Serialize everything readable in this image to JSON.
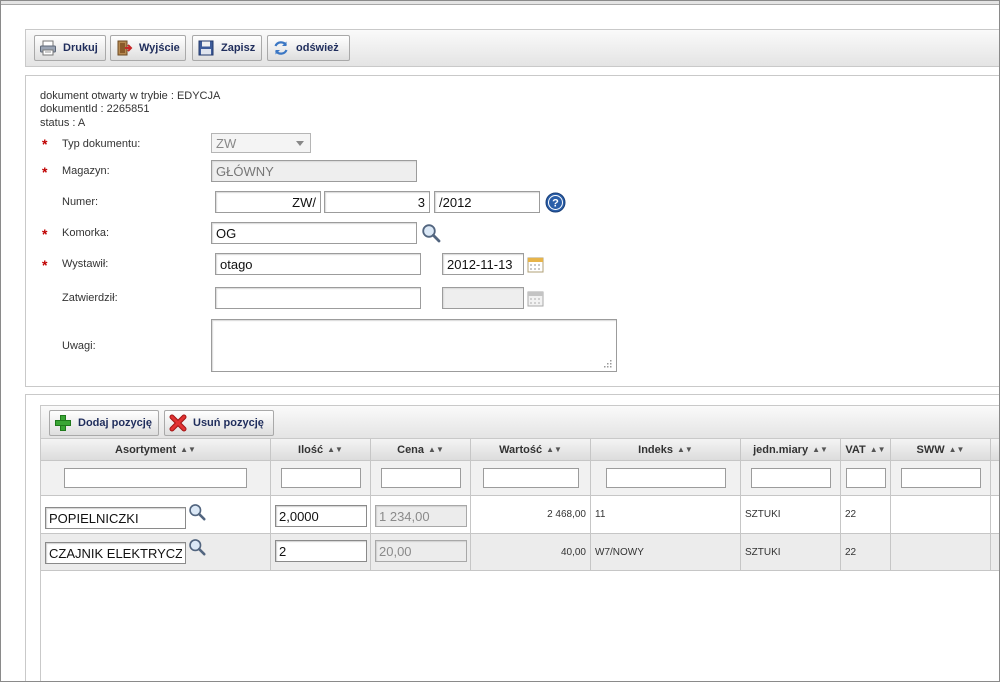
{
  "toolbar": {
    "print_label": "Drukuj",
    "exit_label": "Wyjście",
    "save_label": "Zapisz",
    "refresh_label": "odśwież"
  },
  "info": {
    "mode_line": "dokument otwarty w trybie : EDYCJA",
    "id_line": "dokumentId : 2265851",
    "status_line": "status : A"
  },
  "form": {
    "typ_label": "Typ dokumentu:",
    "typ_value": "ZW",
    "magazyn_label": "Magazyn:",
    "magazyn_value": "GŁÓWNY",
    "numer_label": "Numer:",
    "numer_prefix": "ZW/",
    "numer_value": "3",
    "numer_suffix": "/2012",
    "komorka_label": "Komorka:",
    "komorka_value": "OG",
    "wystawil_label": "Wystawił:",
    "wystawil_value": "otago",
    "wystawil_date": "2012-11-13",
    "zatwierdzil_label": "Zatwierdził:",
    "zatwierdzil_value": "",
    "zatwierdzil_date": "",
    "uwagi_label": "Uwagi:",
    "uwagi_value": ""
  },
  "grid_toolbar": {
    "add_label": "Dodaj pozycję",
    "remove_label": "Usuń pozycję"
  },
  "columns": [
    "Asortyment",
    "Ilość",
    "Cena",
    "Wartość",
    "Indeks",
    "jedn.miary",
    "VAT",
    "SWW"
  ],
  "rows": [
    {
      "asortyment": "POPIELNICZKI",
      "ilosc": "2,0000",
      "cena": "1 234,00",
      "wartosc": "2 468,00",
      "indeks": "11",
      "jm": "SZTUKI",
      "vat": "22",
      "sww": ""
    },
    {
      "asortyment": "CZAJNIK ELEKTRYCZ",
      "ilosc": "2",
      "cena": "20,00",
      "wartosc": "40,00",
      "indeks": "W7/NOWY",
      "jm": "SZTUKI",
      "vat": "22",
      "sww": ""
    }
  ],
  "icons": {
    "print": "printer-icon",
    "exit": "exit-door-icon",
    "save": "floppy-disk-icon",
    "refresh": "refresh-icon",
    "help": "help-icon",
    "search": "search-icon",
    "calendar": "calendar-icon",
    "add": "plus-icon",
    "remove": "delete-x-icon"
  },
  "colors": {
    "required": "#c00000",
    "button_text": "#1f2d5c",
    "help_blue": "#2a5ea8",
    "add_green": "#3aa635",
    "remove_red": "#d42020"
  }
}
